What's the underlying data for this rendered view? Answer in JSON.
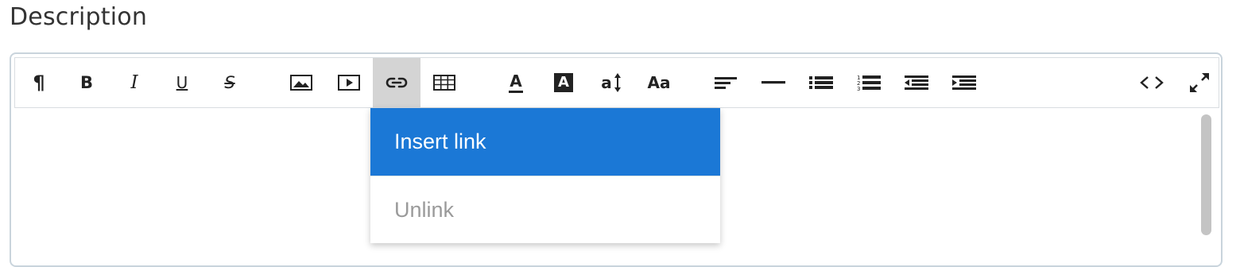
{
  "field": {
    "label": "Description"
  },
  "toolbar": {
    "buttons": [
      {
        "name": "paragraph",
        "glyph": "¶"
      },
      {
        "name": "bold",
        "glyph": "B"
      },
      {
        "name": "italic",
        "glyph": "I"
      },
      {
        "name": "underline",
        "glyph": "U"
      },
      {
        "name": "strikethrough",
        "glyph": "S"
      },
      {
        "name": "image",
        "icon": "image-icon"
      },
      {
        "name": "video",
        "icon": "video-icon"
      },
      {
        "name": "link",
        "icon": "link-icon",
        "active": true
      },
      {
        "name": "table",
        "icon": "table-icon"
      },
      {
        "name": "font-color",
        "glyph": "A"
      },
      {
        "name": "background-color",
        "glyph": "A"
      },
      {
        "name": "line-height",
        "glyph": "a"
      },
      {
        "name": "font-size",
        "glyph": "Aa"
      },
      {
        "name": "align",
        "icon": "align-left-icon"
      },
      {
        "name": "horizontal-rule",
        "icon": "horizontal-rule-icon"
      },
      {
        "name": "unordered-list",
        "icon": "bullet-list-icon"
      },
      {
        "name": "ordered-list",
        "icon": "numbered-list-icon"
      },
      {
        "name": "outdent",
        "icon": "outdent-icon"
      },
      {
        "name": "indent",
        "icon": "indent-icon"
      },
      {
        "name": "code-view",
        "icon": "code-icon"
      },
      {
        "name": "fullscreen",
        "icon": "expand-icon"
      }
    ],
    "active_color": "#d4d4d4"
  },
  "link_menu": {
    "items": [
      {
        "label": "Insert link",
        "state": "highlighted"
      },
      {
        "label": "Unlink",
        "state": "disabled"
      }
    ],
    "highlight_color": "#1b78d6"
  }
}
